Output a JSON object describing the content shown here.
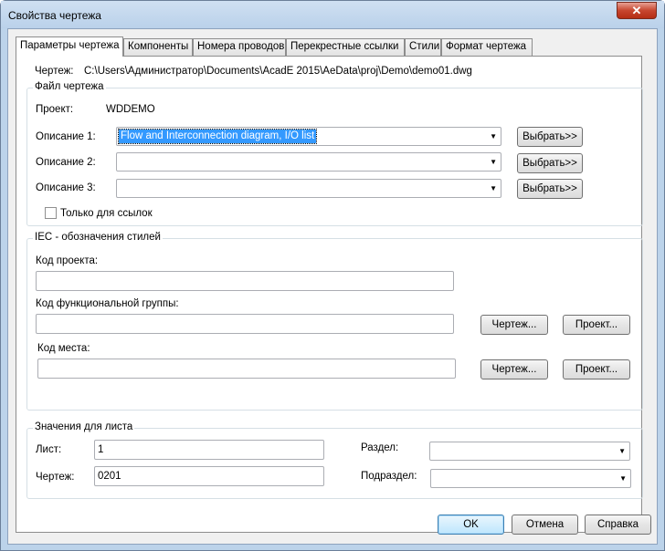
{
  "window": {
    "title": "Свойства чертежа",
    "close_glyph": "✕"
  },
  "tabs": [
    {
      "label": "Параметры чертежа"
    },
    {
      "label": "Компоненты"
    },
    {
      "label": "Номера проводов"
    },
    {
      "label": "Перекрестные ссылки"
    },
    {
      "label": "Стили"
    },
    {
      "label": "Формат чертежа"
    }
  ],
  "drawing": {
    "label": "Чертеж:",
    "path": "C:\\Users\\Администратор\\Documents\\AcadE 2015\\AeData\\proj\\Demo\\demo01.dwg"
  },
  "file_group": {
    "title": "Файл чертежа",
    "project_label": "Проект:",
    "project_value": "WDDEMO",
    "descriptions": [
      {
        "label": "Описание 1:",
        "value": "Flow and Interconnection diagram, I/O list",
        "button": "Выбрать>>"
      },
      {
        "label": "Описание 2:",
        "value": "",
        "button": "Выбрать>>"
      },
      {
        "label": "Описание 3:",
        "value": "",
        "button": "Выбрать>>"
      }
    ],
    "ref_only_label": "Только для ссылок",
    "ref_only_checked": false
  },
  "iec_group": {
    "title": "IEC - обозначения стилей",
    "project_code_label": "Код проекта:",
    "project_code_value": "",
    "func_group_label": "Код функциональной группы:",
    "func_group_value": "",
    "location_label": "Код места:",
    "location_value": "",
    "drawing_button": "Чертеж...",
    "project_button": "Проект..."
  },
  "sheet_group": {
    "title": "Значения для листа",
    "sheet_label": "Лист:",
    "sheet_value": "1",
    "drawing_label": "Чертеж:",
    "drawing_value": "0201",
    "section_label": "Раздел:",
    "section_value": "",
    "subsection_label": "Подраздел:",
    "subsection_value": ""
  },
  "footer": {
    "ok": "OK",
    "cancel": "Отмена",
    "help": "Справка"
  },
  "icons": {
    "dropdown": "▼"
  }
}
